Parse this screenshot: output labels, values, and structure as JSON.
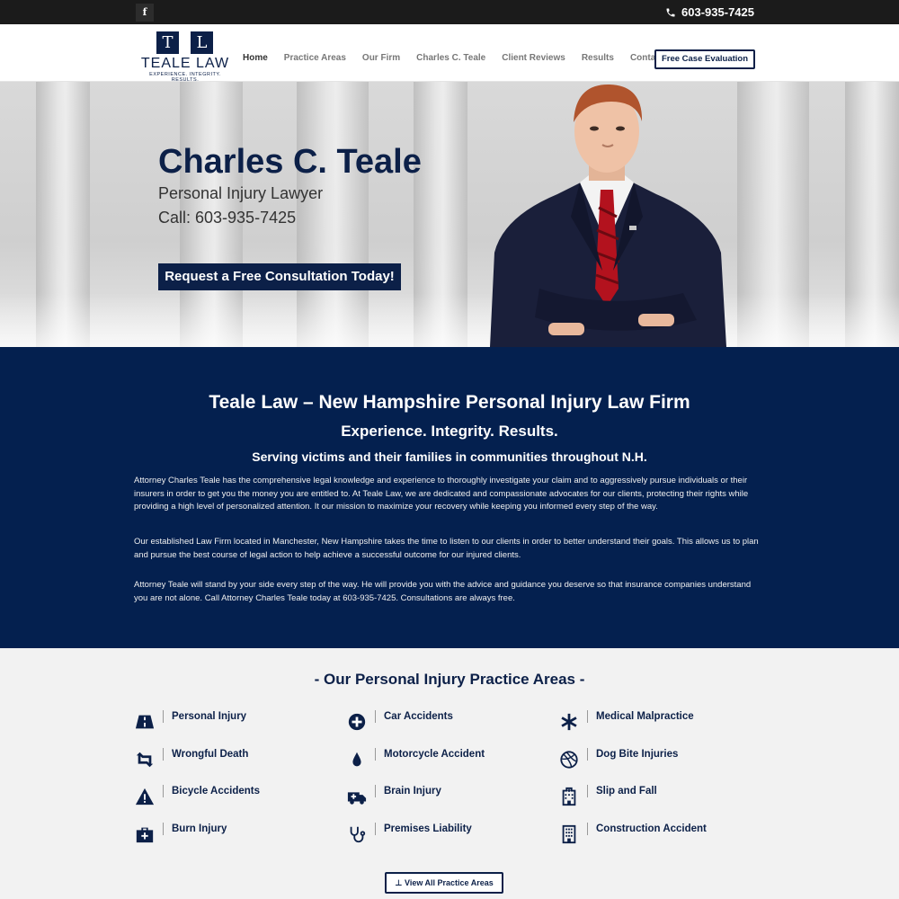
{
  "topbar": {
    "facebook_icon": "facebook-icon",
    "phone": "603-935-7425"
  },
  "logo": {
    "letter_t": "T",
    "letter_l": "L",
    "name": "TEALE LAW",
    "tagline": "EXPERIENCE. INTEGRITY. RESULTS."
  },
  "nav": {
    "items": [
      {
        "label": "Home"
      },
      {
        "label": "Practice Areas"
      },
      {
        "label": "Our Firm"
      },
      {
        "label": "Charles C. Teale"
      },
      {
        "label": "Client Reviews"
      },
      {
        "label": "Results"
      },
      {
        "label": "Contact"
      }
    ],
    "cta": "Free Case Evaluation"
  },
  "hero": {
    "title": "Charles C. Teale",
    "subtitle": "Personal Injury Lawyer",
    "call": "Call: 603-935-7425",
    "button": "Request a Free Consultation Today!"
  },
  "intro": {
    "heading": "Teale Law – New Hampshire Personal Injury Law Firm",
    "slogan": "Experience. Integrity. Results.",
    "serving": "Serving victims and their families in communities throughout N.H.",
    "p1": "Attorney Charles Teale has the comprehensive legal knowledge and experience to thoroughly investigate your claim and to aggressively pursue individuals or their insurers in order to get you the money you are entitled to. At Teale Law, we are dedicated and compassionate advocates for our clients, protecting their rights while providing a high level of personalized attention. It our mission to maximize your recovery while keeping you informed every step of the way.",
    "p2": "Our established Law Firm located in Manchester, New Hampshire takes the time to listen to our clients in order to better understand their goals. This allows us to plan and pursue the best course of legal action to help achieve a successful outcome for our injured clients.",
    "p3": "Attorney Teale will stand by your side every step of the way. He will provide you with the advice and guidance you deserve so that insurance companies understand you are not alone. Call Attorney Charles Teale today at 603-935-7425. Consultations are always free."
  },
  "areas": {
    "title": "- Our Personal Injury Practice Areas -",
    "items": [
      {
        "label": "Personal Injury",
        "icon": "road-icon"
      },
      {
        "label": "Car Accidents",
        "icon": "plus-circle-icon"
      },
      {
        "label": "Medical Malpractice",
        "icon": "asterisk-icon"
      },
      {
        "label": "Wrongful Death",
        "icon": "retweet-icon"
      },
      {
        "label": "Motorcycle Accident",
        "icon": "drop-icon"
      },
      {
        "label": "Dog Bite Injuries",
        "icon": "dribbble-icon"
      },
      {
        "label": "Bicycle Accidents",
        "icon": "warning-icon"
      },
      {
        "label": "Brain Injury",
        "icon": "ambulance-icon"
      },
      {
        "label": "Slip and Fall",
        "icon": "hospital-icon"
      },
      {
        "label": "Burn Injury",
        "icon": "medkit-icon"
      },
      {
        "label": "Premises Liability",
        "icon": "stethoscope-icon"
      },
      {
        "label": "Construction Accident",
        "icon": "building-icon"
      }
    ],
    "view_all": "View All Practice Areas"
  }
}
